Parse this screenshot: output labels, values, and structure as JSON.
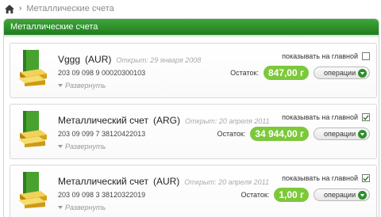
{
  "breadcrumb": {
    "current": "Металлические счета"
  },
  "panel": {
    "title": "Металлические счета"
  },
  "accounts": [
    {
      "name": "Vggg",
      "metal": "(AUR)",
      "opened": "Открыт: 29 января 2008",
      "number": "203 09 098 9 00020300103",
      "expand": "Развернуть",
      "show_label": "показывать на главной",
      "show_checked": false,
      "balance_label": "Остаток:",
      "balance": "847,00 г",
      "ops_label": "операции"
    },
    {
      "name": "Металлический счет",
      "metal": "(ARG)",
      "opened": "Открыт: 20 апреля 2011",
      "number": "203 09 099 7 38120422013",
      "expand": "Развернуть",
      "show_label": "показывать на главной",
      "show_checked": true,
      "balance_label": "Остаток:",
      "balance": "34 944,00 г",
      "ops_label": "операции"
    },
    {
      "name": "Металлический счет",
      "metal": "(AUR)",
      "opened": "Открыт: 20 апреля 2011",
      "number": "203 09 098 3 38120322019",
      "expand": "Развернуть",
      "show_label": "показывать на главной",
      "show_checked": true,
      "balance_label": "Остаток:",
      "balance": "1,00 г",
      "ops_label": "операции"
    }
  ],
  "colors": {
    "header_green": "#2e8f2b",
    "balance_green": "#7cc83a",
    "gold": "#d7a21a"
  },
  "icons": {
    "home": "home-icon",
    "account": "gold-bars-icon",
    "ops": "chevron-down-circle-icon"
  }
}
